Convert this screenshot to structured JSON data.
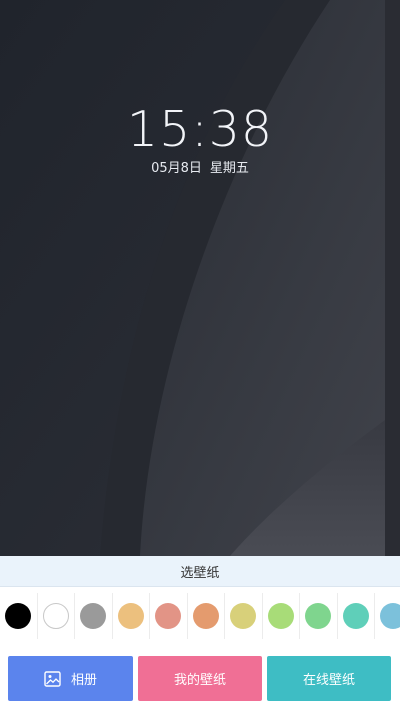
{
  "lockscreen": {
    "time": "15:38",
    "date": "05月8日",
    "weekday": "星期五"
  },
  "panel": {
    "title": "选壁纸"
  },
  "colors": [
    "#000000",
    "#ffffff",
    "#9a9a9a",
    "#ecc07e",
    "#e29486",
    "#e49b6e",
    "#d8d07a",
    "#a8dc78",
    "#7fd58e",
    "#5fcfb9",
    "#7cc1db",
    "#6a7ec4"
  ],
  "buttons": {
    "album_label": "相册",
    "album_color": "#5b84ed",
    "my_wallpaper_label": "我的壁纸",
    "my_wallpaper_color": "#f06f95",
    "online_wallpaper_label": "在线壁纸",
    "online_wallpaper_color": "#3ebdc4"
  },
  "icons": {
    "album": "image-icon"
  }
}
